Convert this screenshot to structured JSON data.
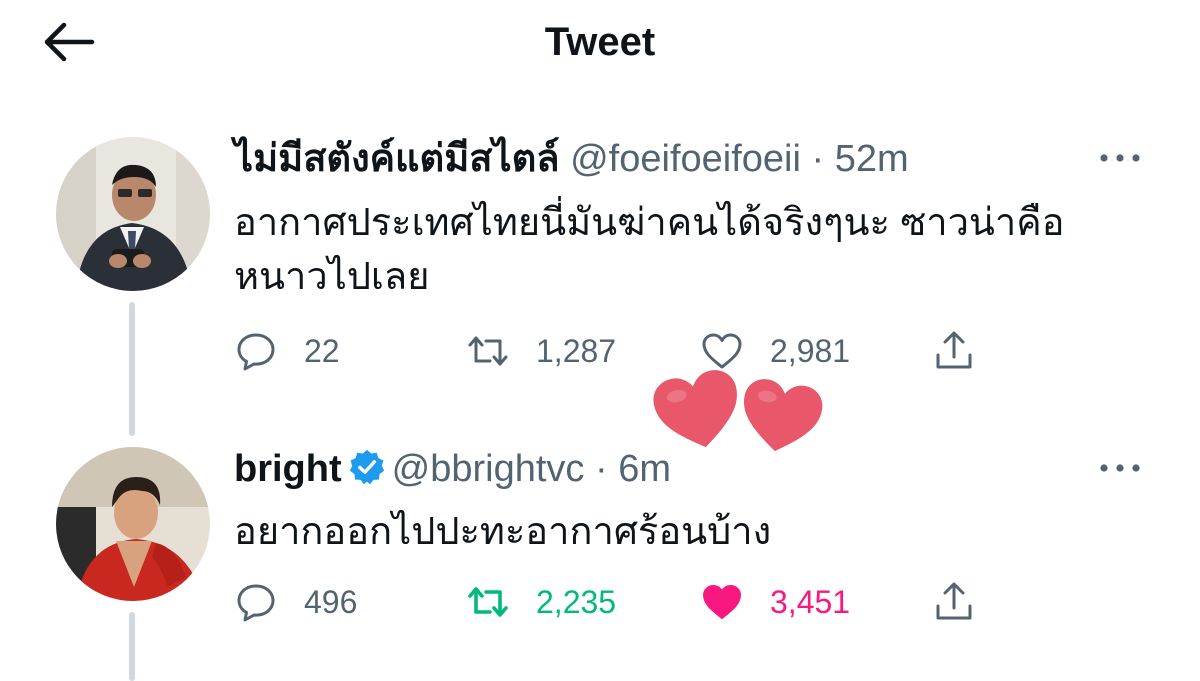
{
  "header": {
    "title": "Tweet"
  },
  "tweets": [
    {
      "name": "ไม่มีสตังค์แต่มีสไตล์",
      "handle": "@foeifoeifoeii",
      "separator": "·",
      "time": "52m",
      "verified": false,
      "text_lines": [
        "อากาศประเทศไทยนี่มันฆ่าคนได้จริงๆนะ ซาวน่าคือ",
        "หนาวไปเลย"
      ],
      "replies": "22",
      "retweets": "1,287",
      "likes": "2,981",
      "retweeted": false,
      "liked": false
    },
    {
      "name": "bright",
      "handle": "@bbrightvc",
      "separator": "·",
      "time": "6m",
      "verified": true,
      "text_lines": [
        "อยากออกไปปะทะอากาศร้อนบ้าง"
      ],
      "replies": "496",
      "retweets": "2,235",
      "likes": "3,451",
      "retweeted": true,
      "liked": true
    }
  ],
  "icons": {
    "back": "arrow-left-icon",
    "more": "more-dots-icon",
    "reply": "reply-bubble-icon",
    "retweet": "retweet-icon",
    "like": "heart-icon",
    "share": "share-icon",
    "verified": "verified-badge-icon"
  },
  "colors": {
    "text": "#0f1419",
    "secondary": "#536471",
    "retweet_active": "#00ba7c",
    "like_active": "#f91880",
    "verified": "#1d9bf0",
    "thread_line": "#cfd9de",
    "sticker_heart": "#e8586a"
  }
}
